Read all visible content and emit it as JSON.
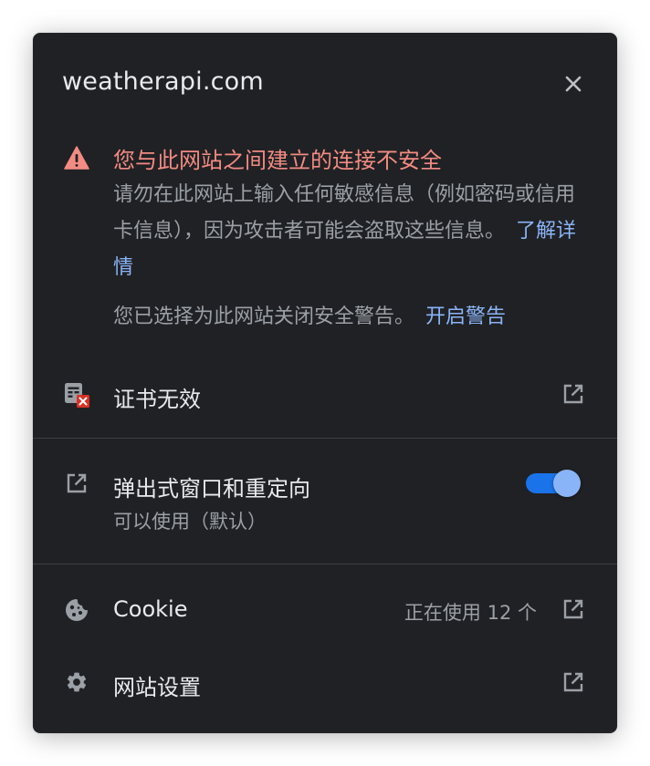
{
  "header": {
    "site": "weatherapi.com"
  },
  "icons": {
    "close": "close-icon",
    "warning": "warning-icon",
    "certificate": "certificate-error-icon",
    "popup": "open-in-new-icon",
    "cookie": "cookie-icon",
    "settings": "gear-icon",
    "external": "open-in-new-icon"
  },
  "colors": {
    "panel_bg": "#202124",
    "warning": "#f28b82",
    "link": "#8ab4f8",
    "toggle_on": "#1a73e8",
    "secondary_text": "#9aa0a6"
  },
  "security": {
    "title": "您与此网站之间建立的连接不安全",
    "body": "请勿在此网站上输入任何敏感信息（例如密码或信用卡信息），因为攻击者可能会盗取这些信息。",
    "learn_more": "了解详情",
    "note": "您已选择为此网站关闭安全警告。",
    "enable_warnings": "开启警告"
  },
  "certificate": {
    "label": "证书无效"
  },
  "popups": {
    "label": "弹出式窗口和重定向",
    "status": "可以使用（默认）",
    "enabled": true
  },
  "cookies": {
    "label": "Cookie",
    "value": "正在使用 12 个"
  },
  "site_settings": {
    "label": "网站设置"
  }
}
